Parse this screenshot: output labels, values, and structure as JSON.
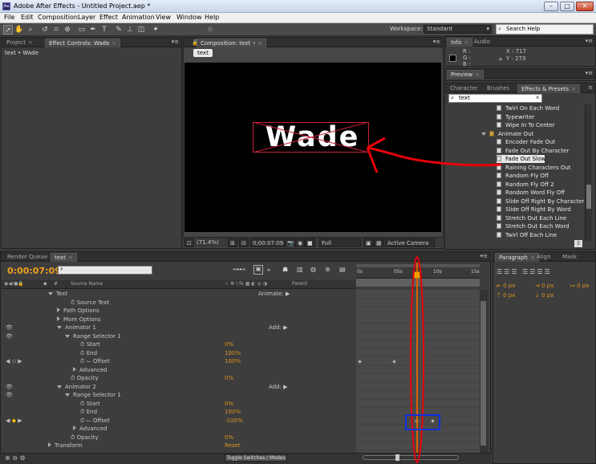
{
  "window": {
    "title": "Adobe After Effects - Untitled Project.aep *",
    "app_icon": "Ae"
  },
  "menu": [
    "File",
    "Edit",
    "Composition",
    "Layer",
    "Effect",
    "Animation",
    "View",
    "Window",
    "Help"
  ],
  "workspace": {
    "label": "Workspace:",
    "value": "Standard"
  },
  "search_help": {
    "placeholder": "Search Help"
  },
  "project_panel": {
    "tabs": [
      "Project",
      "Effect Controls: Wade"
    ],
    "breadcrumb": "text • Wade"
  },
  "comp_panel": {
    "tab": "Composition: text",
    "sub_tab": "text",
    "text": "Wade"
  },
  "comp_controls": {
    "zoom": "(71.4%)",
    "timecode": "0;00:07:09",
    "resolution": "Full",
    "camera": "Active Camera"
  },
  "info_panel": {
    "tabs": [
      "Info",
      "Audio"
    ],
    "r": "R :",
    "g": "G :",
    "b": "B :",
    "x": "X : 717",
    "y": "Y : 273"
  },
  "preview_panel": {
    "tab": "Preview"
  },
  "effects_panel": {
    "tabs": [
      "Character",
      "Brushes",
      "Effects & Presets"
    ],
    "search": "text",
    "items": [
      {
        "label": "Twirl On Each Word",
        "type": "preset"
      },
      {
        "label": "Typewriter",
        "type": "preset"
      },
      {
        "label": "Wipe In To Center",
        "type": "preset"
      },
      {
        "label": "Animate Out",
        "type": "folder"
      },
      {
        "label": "Encoder Fade Out",
        "type": "preset"
      },
      {
        "label": "Fade Out By Character",
        "type": "preset"
      },
      {
        "label": "Fade Out Slow",
        "type": "preset",
        "selected": true
      },
      {
        "label": "Raining Characters Out",
        "type": "preset"
      },
      {
        "label": "Random Fly Off",
        "type": "preset"
      },
      {
        "label": "Random Fly Off 2",
        "type": "preset"
      },
      {
        "label": "Random Word Fly Off",
        "type": "preset"
      },
      {
        "label": "Slide Off Right By Character",
        "type": "preset"
      },
      {
        "label": "Slide Off Right By Word",
        "type": "preset"
      },
      {
        "label": "Stretch Out Each Line",
        "type": "preset"
      },
      {
        "label": "Stretch Out Each Word",
        "type": "preset"
      },
      {
        "label": "Twirl Off Each Line",
        "type": "preset"
      }
    ]
  },
  "timeline": {
    "tabs": [
      "Render Queue",
      "text"
    ],
    "timecode": "0:00:07:09",
    "columns": {
      "num": "#",
      "source": "Source Name",
      "parent": "Parent"
    },
    "ruler": [
      "0s",
      "05s",
      "10s",
      "15s"
    ],
    "toggle_label": "Toggle Switches / Modes",
    "rows": [
      {
        "label": "Text",
        "indent": 0,
        "twirl": "open",
        "add": "Animate:"
      },
      {
        "label": "Source Text",
        "indent": 1,
        "stopwatch": true
      },
      {
        "label": "Path Options",
        "indent": 1,
        "twirl": "closed"
      },
      {
        "label": "More Options",
        "indent": 1,
        "twirl": "closed"
      },
      {
        "label": "Animator 1",
        "indent": 1,
        "twirl": "open",
        "add": "Add:",
        "eye": true
      },
      {
        "label": "Range Selector 1",
        "indent": 2,
        "twirl": "open",
        "eye": true
      },
      {
        "label": "Start",
        "indent": 3,
        "stopwatch": true,
        "value": "0%"
      },
      {
        "label": "End",
        "indent": 3,
        "stopwatch": true,
        "value": "100%"
      },
      {
        "label": "Offset",
        "indent": 3,
        "stopwatch": true,
        "value": "100%",
        "nav": true
      },
      {
        "label": "Advanced",
        "indent": 3,
        "twirl": "closed"
      },
      {
        "label": "Opacity",
        "indent": 2,
        "stopwatch": true,
        "value": "0%"
      },
      {
        "label": "Animator 2",
        "indent": 1,
        "twirl": "open",
        "add": "Add:",
        "eye": true
      },
      {
        "label": "Range Selector 1",
        "indent": 2,
        "twirl": "open",
        "eye": true
      },
      {
        "label": "Start",
        "indent": 3,
        "stopwatch": true,
        "value": "0%"
      },
      {
        "label": "End",
        "indent": 3,
        "stopwatch": true,
        "value": "100%"
      },
      {
        "label": "Offset",
        "indent": 3,
        "stopwatch": true,
        "value": "-100%",
        "nav": true
      },
      {
        "label": "Advanced",
        "indent": 3,
        "twirl": "closed"
      },
      {
        "label": "Opacity",
        "indent": 2,
        "stopwatch": true,
        "value": "0%"
      },
      {
        "label": "Transform",
        "indent": 0,
        "twirl": "closed",
        "reset": "Reset"
      }
    ]
  },
  "paragraph_panel": {
    "tabs": [
      "Paragraph",
      "Align",
      "Mask"
    ],
    "px_fields": [
      "0 px",
      "0 px",
      "0 px",
      "0 px",
      "0 px"
    ]
  },
  "colors": {
    "accent": "#f0a020",
    "annotation_red": "#e8000a",
    "annotation_blue": "#1030e0"
  }
}
